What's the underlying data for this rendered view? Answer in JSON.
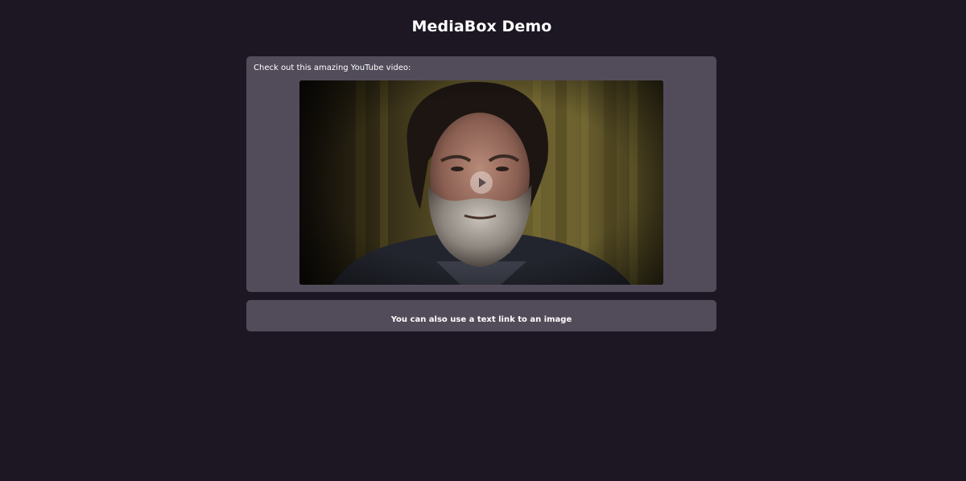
{
  "page": {
    "title": "MediaBox Demo"
  },
  "video_section": {
    "caption": "Check out this amazing YouTube video:",
    "thumbnail_description": "bearded-man-video-thumbnail",
    "play_icon": "play-icon"
  },
  "link_section": {
    "link_text": "You can also use a text link to an image"
  },
  "colors": {
    "background": "#1c1723",
    "card": "#524c5a",
    "text": "#ffffff"
  }
}
